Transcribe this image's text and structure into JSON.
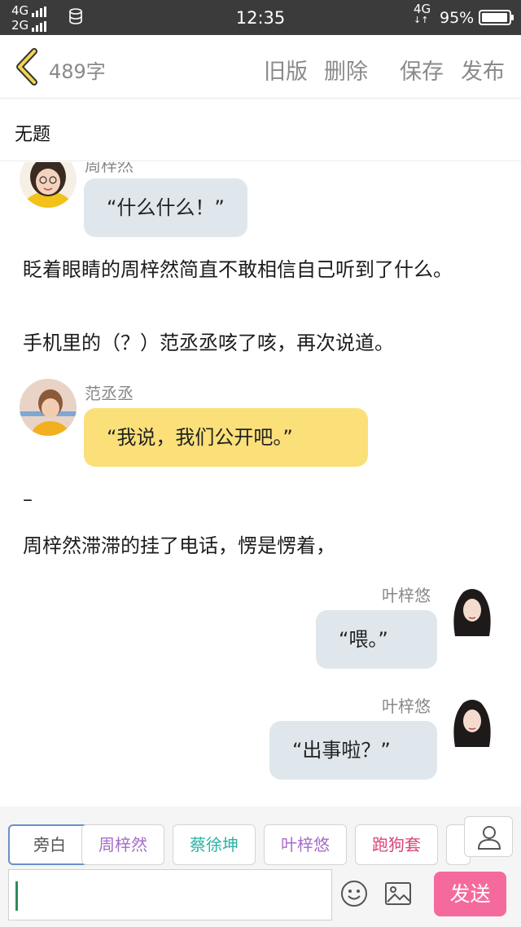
{
  "status": {
    "signal_top": "4G",
    "signal_bottom": "2G",
    "time": "12:35",
    "network": "4G",
    "battery": "95%",
    "battery_level": 0.95
  },
  "toolbar": {
    "word_count": "489字",
    "old_version": "旧版",
    "delete": "删除",
    "save": "保存",
    "publish": "发布"
  },
  "document": {
    "title": "无题"
  },
  "messages": {
    "m1": {
      "speaker": "周梓然",
      "text": "“什么什么！”"
    },
    "n1": "眨着眼睛的周梓然简直不敢相信自己听到了什么。",
    "n2": "手机里的（？）范丞丞咳了咳，再次说道。",
    "m2": {
      "speaker": "范丞丞",
      "text": "“我说，我们公开吧。”"
    },
    "n3": "–",
    "n4": "周梓然滞滞的挂了电话，愣是愣着，",
    "m3": {
      "speaker": "叶梓悠",
      "text": "“喂。”"
    },
    "m4": {
      "speaker": "叶梓悠",
      "text": "“出事啦？”"
    }
  },
  "characters": [
    {
      "label": "旁白",
      "color": "#555555"
    },
    {
      "label": "周梓然",
      "color": "#a66cc9"
    },
    {
      "label": "蔡徐坤",
      "color": "#2bb3a3"
    },
    {
      "label": "叶梓悠",
      "color": "#a66cc9"
    },
    {
      "label": "跑狗套",
      "color": "#d9437a"
    }
  ],
  "input": {
    "value": "",
    "send_label": "发送"
  },
  "colors": {
    "accent_send": "#f56a9c",
    "bubble_grey": "#dfe7ec",
    "bubble_yellow": "#fbe07a"
  }
}
